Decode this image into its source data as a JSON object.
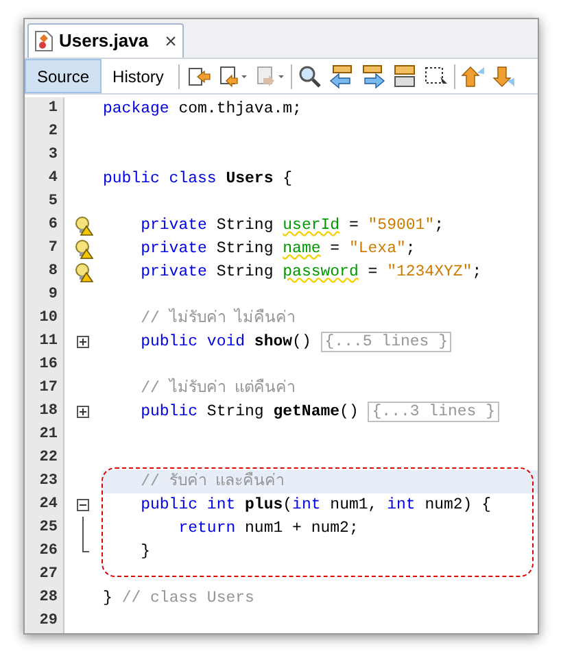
{
  "editor_tab": {
    "title": "Users.java",
    "close": "×"
  },
  "view_tabs": [
    {
      "label": "Source",
      "selected": true
    },
    {
      "label": "History",
      "selected": false
    }
  ],
  "lines": [
    {
      "number": "1",
      "kind": "plain",
      "tokens": [
        {
          "kind": "kw",
          "text": "package"
        },
        {
          "kind": "plain",
          "text": " com.thjava.m;"
        }
      ]
    },
    {
      "number": "2",
      "kind": "plain"
    },
    {
      "number": "3",
      "kind": "plain"
    },
    {
      "number": "4",
      "kind": "plain",
      "tokens": [
        {
          "kind": "kw",
          "text": "public class"
        },
        {
          "kind": "decl",
          "text": " Users"
        },
        {
          "kind": "plain",
          "text": " {"
        }
      ]
    },
    {
      "number": "5",
      "kind": "plain"
    },
    {
      "number": "6",
      "kind": "warning",
      "tokens": [
        {
          "kind": "kw",
          "text": "    private"
        },
        {
          "kind": "plain",
          "text": " String "
        },
        {
          "kind": "field",
          "text": "userId"
        },
        {
          "kind": "plain",
          "text": " = "
        },
        {
          "kind": "str",
          "text": "\"59001\""
        },
        {
          "kind": "plain",
          "text": ";"
        }
      ]
    },
    {
      "number": "7",
      "kind": "warning",
      "tokens": [
        {
          "kind": "kw",
          "text": "    private"
        },
        {
          "kind": "plain",
          "text": " String "
        },
        {
          "kind": "field",
          "text": "name"
        },
        {
          "kind": "plain",
          "text": " = "
        },
        {
          "kind": "str",
          "text": "\"Lexa\""
        },
        {
          "kind": "plain",
          "text": ";"
        }
      ]
    },
    {
      "number": "8",
      "kind": "warning",
      "tokens": [
        {
          "kind": "kw",
          "text": "    private"
        },
        {
          "kind": "plain",
          "text": " String "
        },
        {
          "kind": "field",
          "text": "password"
        },
        {
          "kind": "plain",
          "text": " = "
        },
        {
          "kind": "str",
          "text": "\"1234XYZ\""
        },
        {
          "kind": "plain",
          "text": ";"
        }
      ]
    },
    {
      "number": "9",
      "kind": "plain"
    },
    {
      "number": "10",
      "kind": "plain",
      "tokens": [
        {
          "kind": "comment",
          "text": "    // ไม่รับค่า ไม่คืนค่า"
        }
      ]
    },
    {
      "number": "11",
      "kind": "fold-plus",
      "tokens": [
        {
          "kind": "kw",
          "text": "    public void"
        },
        {
          "kind": "decl",
          "text": " show"
        },
        {
          "kind": "plain",
          "text": "() "
        },
        {
          "kind": "folded",
          "text": "{...5 lines }"
        }
      ]
    },
    {
      "number": "16",
      "kind": "plain"
    },
    {
      "number": "17",
      "kind": "plain",
      "tokens": [
        {
          "kind": "comment",
          "text": "    // ไม่รับค่า แต่คืนค่า"
        }
      ]
    },
    {
      "number": "18",
      "kind": "fold-plus",
      "tokens": [
        {
          "kind": "kw",
          "text": "    public"
        },
        {
          "kind": "plain",
          "text": " String"
        },
        {
          "kind": "decl",
          "text": " getName"
        },
        {
          "kind": "plain",
          "text": "() "
        },
        {
          "kind": "folded",
          "text": "{...3 lines }"
        }
      ]
    },
    {
      "number": "21",
      "kind": "plain"
    },
    {
      "number": "22",
      "kind": "plain"
    },
    {
      "number": "23",
      "kind": "plain",
      "highlighted": true,
      "boxed": true,
      "tokens": [
        {
          "kind": "comment",
          "text": "    // รับค่า และคืนค่า"
        }
      ]
    },
    {
      "number": "24",
      "kind": "fold-minus",
      "boxed": true,
      "tokens": [
        {
          "kind": "kw",
          "text": "    public int"
        },
        {
          "kind": "decl",
          "text": " plus"
        },
        {
          "kind": "plain",
          "text": "("
        },
        {
          "kind": "kw",
          "text": "int"
        },
        {
          "kind": "plain",
          "text": " num1, "
        },
        {
          "kind": "kw",
          "text": "int"
        },
        {
          "kind": "plain",
          "text": " num2) {"
        }
      ]
    },
    {
      "number": "25",
      "kind": "fold-line",
      "boxed": true,
      "tokens": [
        {
          "kind": "kw",
          "text": "        return"
        },
        {
          "kind": "plain",
          "text": " num1 + num2;"
        }
      ]
    },
    {
      "number": "26",
      "kind": "fold-end",
      "boxed": true,
      "tokens": [
        {
          "kind": "plain",
          "text": "    }"
        }
      ]
    },
    {
      "number": "27",
      "kind": "plain"
    },
    {
      "number": "28",
      "kind": "plain",
      "tokens": [
        {
          "kind": "plain",
          "text": "} "
        },
        {
          "kind": "comment",
          "text": "// class Users"
        }
      ]
    },
    {
      "number": "29",
      "kind": "plain"
    }
  ]
}
